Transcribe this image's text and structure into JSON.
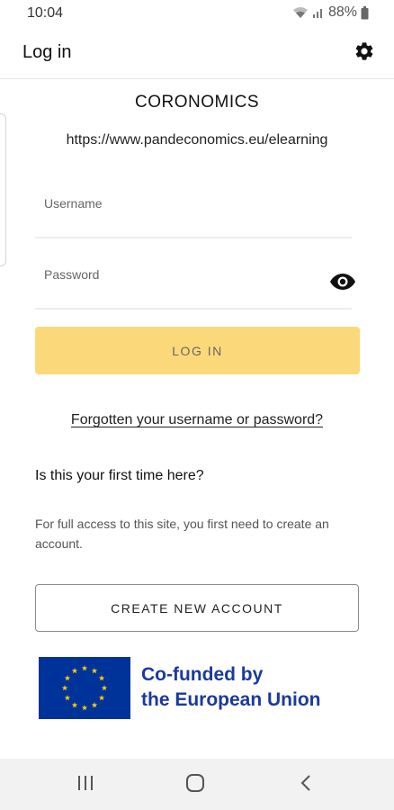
{
  "status_bar": {
    "time": "10:04",
    "battery": "88%",
    "icons": [
      "wifi-icon",
      "signal-icon",
      "battery-icon"
    ]
  },
  "app_bar": {
    "title": "Log in",
    "settings_icon": "gear-icon"
  },
  "site": {
    "name": "CORONOMICS",
    "url": "https://www.pandeconomics.eu/elearning"
  },
  "form": {
    "username_placeholder": "Username",
    "username_value": "",
    "password_placeholder": "Password",
    "password_value": "",
    "password_toggle_icon": "eye-icon",
    "login_label": "LOG IN"
  },
  "forgot_link": "Forgotten your username or password?",
  "signup": {
    "heading": "Is this your first time here?",
    "info": "For full access to this site, you first need to create an account.",
    "button_label": "CREATE NEW ACCOUNT"
  },
  "eu_logo": {
    "line1": "Co-funded by",
    "line2": "the European Union"
  },
  "nav_bar": {
    "icons": [
      "recents-icon",
      "home-icon",
      "back-icon"
    ]
  },
  "colors": {
    "login_button": "#fbd97a",
    "eu_blue": "#003399",
    "eu_star": "#ffcc00",
    "eu_text": "#1a3a9c"
  }
}
